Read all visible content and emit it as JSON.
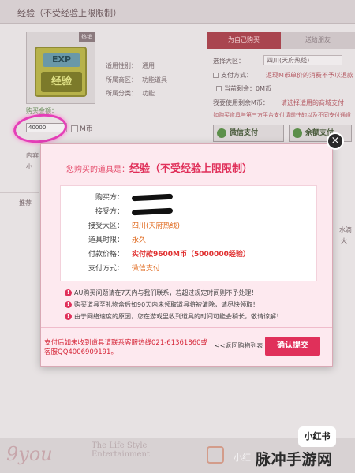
{
  "header": {
    "title": "经验（不受经验上限限制）"
  },
  "product": {
    "tag": "热销",
    "image_top": "EXP",
    "image_bottom": "经验",
    "info": [
      {
        "label": "适用性别：",
        "value": "通用"
      },
      {
        "label": "所属商区：",
        "value": "功能道具"
      },
      {
        "label": "所属分类：",
        "value": "功能"
      }
    ]
  },
  "purchase_tabs": {
    "tab1": "为自己购买",
    "tab2": "送给朋友"
  },
  "form": {
    "region_label": "选择大区：",
    "region_value": "四川(天府热线)",
    "pay_method_label": "支付方式：",
    "pay_method_note": "返现M币单价的消费不予以退款",
    "current_balance_label": "当前剩余：",
    "current_balance_value": "0M币",
    "use_balance_label": "我要使用剩余M币：",
    "use_balance_note": "请选择适用的商城支付",
    "purchase_tip": "如购买道具与第三方平台支付请前往的以及不同支付通道"
  },
  "payment_buttons": {
    "wechat": "微信支付",
    "balance": "余额支付"
  },
  "amount": {
    "label": "购买金额：",
    "value": "40000",
    "unit": "M币"
  },
  "left_fragments": {
    "f1": "内容",
    "f2": "小",
    "f3": "推荐"
  },
  "right_fragments": {
    "f1": "水滴",
    "f2": "火"
  },
  "modal": {
    "prefix": "您购买的道具是：",
    "title": "经验（不受经验上限限制）",
    "details": {
      "buyer_label": "购买方：",
      "receiver_label": "接受方：",
      "region_label": "接受大区：",
      "region_value": "四川(天府热线)",
      "duration_label": "道具时限：",
      "duration_value": "永久",
      "price_label": "付款价格：",
      "price_value": "实付款9600M币（5000000经验）",
      "method_label": "支付方式：",
      "method_value": "微信支付"
    },
    "notices": [
      "AU购买问题请在7天内与我们联系，若超过规定时间则不予处理！",
      "购买道具至礼物盒后如90天内未领取道具将被清除，请尽快领取！",
      "由于网络速度的原因，您在游戏里收到道具的时间可能会稍长，敬请谅解！"
    ],
    "hotline": "支付后如未收到道具请联系客服热线021-61361860或客服QQ4006909191。",
    "return_link": "<<返回购物列表",
    "confirm": "确认提交",
    "close": "×"
  },
  "footer": {
    "logo1": "9you",
    "logo2": "The Life Style Entertainment",
    "watermark_small": "小红",
    "xhs_badge": "小红书",
    "watermark_main": "脉冲手游网"
  }
}
